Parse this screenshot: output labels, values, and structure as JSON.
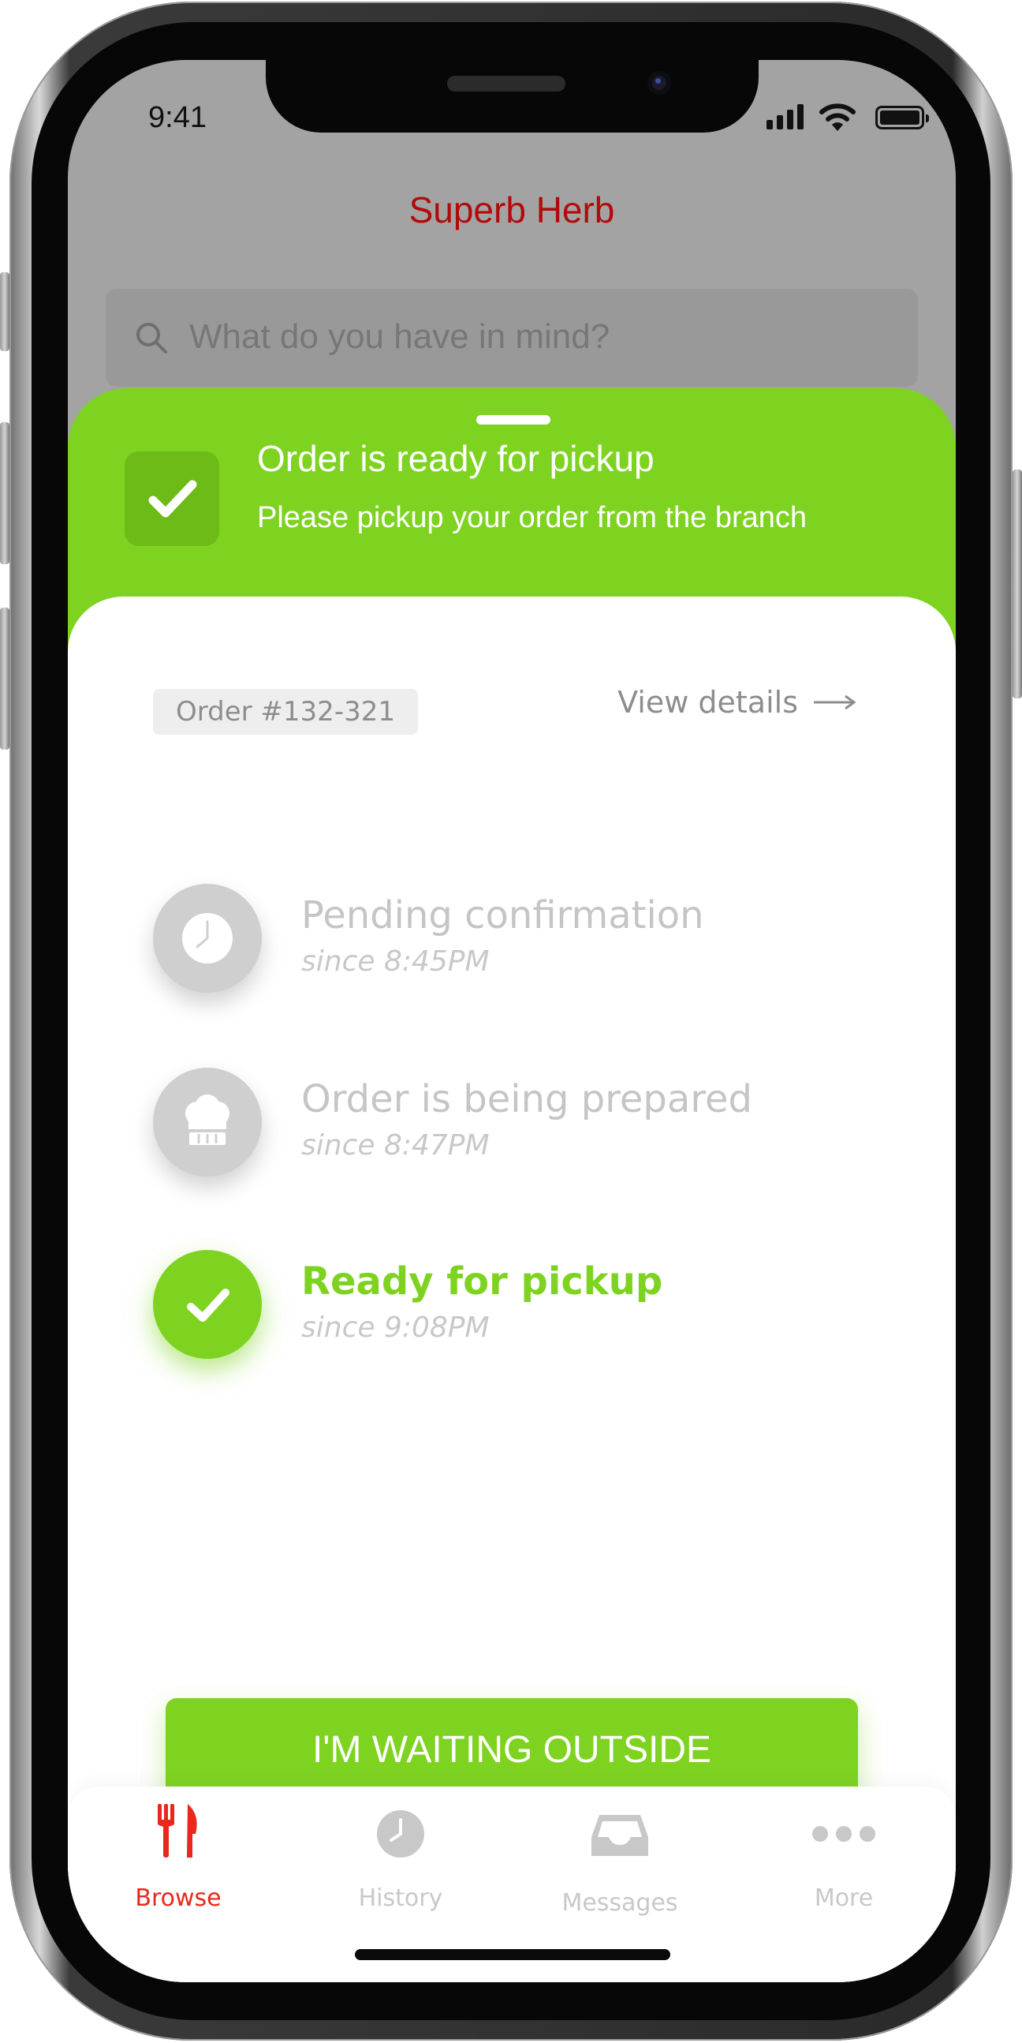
{
  "status_bar": {
    "time": "9:41"
  },
  "app": {
    "title": "Superb Herb"
  },
  "search": {
    "placeholder": "What do you have in mind?"
  },
  "banner": {
    "title": "Order is ready for pickup",
    "subtitle": "Please pickup your order from the branch"
  },
  "order": {
    "number": "Order #132-321",
    "view_details": "View details"
  },
  "steps": [
    {
      "title": "Pending confirmation",
      "time": "since 8:45PM",
      "icon": "clock-icon",
      "active": false
    },
    {
      "title": "Order is being prepared",
      "time": "since 8:47PM",
      "icon": "chef-hat-icon",
      "active": false
    },
    {
      "title": "Ready for pickup",
      "time": "since 9:08PM",
      "icon": "check-icon",
      "active": true
    }
  ],
  "cta": {
    "label": "I'M WAITING OUTSIDE"
  },
  "tabs": [
    {
      "label": "Browse",
      "icon": "fork-knife-icon",
      "active": true
    },
    {
      "label": "History",
      "icon": "clock-icon",
      "active": false
    },
    {
      "label": "Messages",
      "icon": "inbox-icon",
      "active": false
    },
    {
      "label": "More",
      "icon": "more-dots-icon",
      "active": false
    }
  ],
  "colors": {
    "accent_green": "#7ed321",
    "brand_red": "#b20a0a",
    "tab_active": "#e8281c",
    "inactive_gray": "#c8c8c8"
  }
}
